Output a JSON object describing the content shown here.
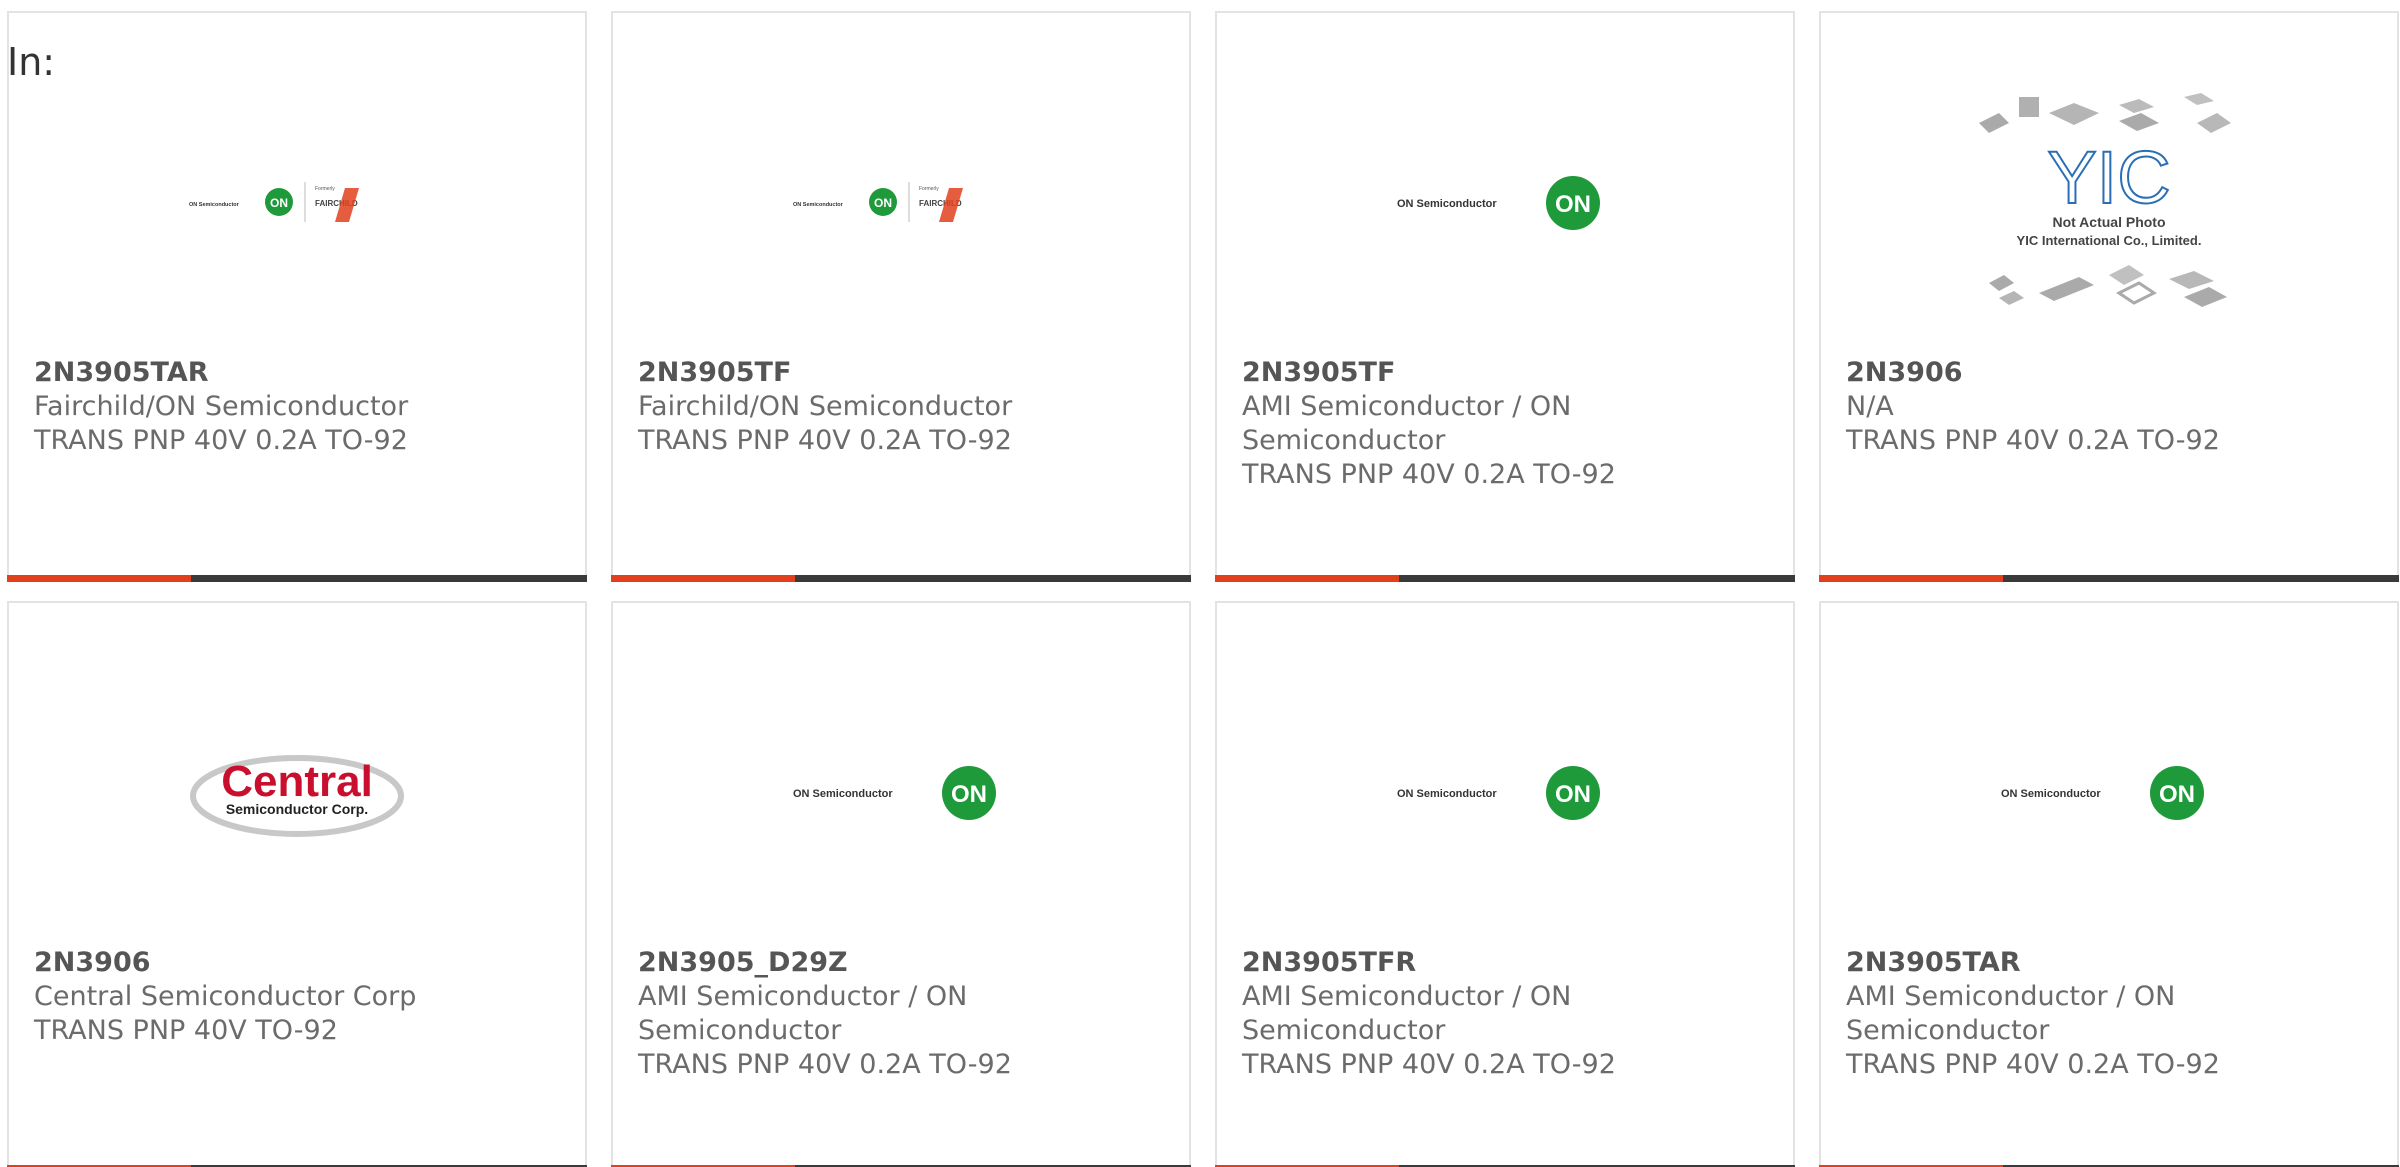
{
  "in_label": "In:",
  "products": [
    {
      "part": "2N3905TAR",
      "manufacturer": "Fairchild/ON Semiconductor",
      "description": "TRANS PNP 40V 0.2A TO-92",
      "logo": "fairchild-on-logo",
      "logo_text": "ON Semiconductor",
      "logo_badge": "ON",
      "logo_extra_small": "Formerly",
      "logo_extra": "FAIRCHILD"
    },
    {
      "part": "2N3905TF",
      "manufacturer": "Fairchild/ON Semiconductor",
      "description": "TRANS PNP 40V 0.2A TO-92",
      "logo": "fairchild-on-logo",
      "logo_text": "ON Semiconductor",
      "logo_badge": "ON",
      "logo_extra_small": "Formerly",
      "logo_extra": "FAIRCHILD"
    },
    {
      "part": "2N3905TF",
      "manufacturer": "AMI Semiconductor / ON Semiconductor",
      "description": "TRANS PNP 40V 0.2A TO-92",
      "logo": "on-semi-logo",
      "logo_text": "ON Semiconductor",
      "logo_badge": "ON"
    },
    {
      "part": "2N3906",
      "manufacturer": "N/A",
      "description": "TRANS PNP 40V 0.2A TO-92",
      "logo": "yic-placeholder-logo",
      "logo_text": "Not Actual Photo",
      "logo_sub": "YIC International Co., Limited.",
      "logo_badge": "YIC"
    },
    {
      "part": "2N3906",
      "manufacturer": "Central Semiconductor Corp",
      "description": "TRANS PNP 40V TO-92",
      "logo": "central-semi-logo",
      "logo_text": "Central",
      "logo_sub": "Semiconductor Corp."
    },
    {
      "part": "2N3905_D29Z",
      "manufacturer": "AMI Semiconductor / ON Semiconductor",
      "description": "TRANS PNP 40V 0.2A TO-92",
      "logo": "on-semi-logo",
      "logo_text": "ON Semiconductor",
      "logo_badge": "ON"
    },
    {
      "part": "2N3905TFR",
      "manufacturer": "AMI Semiconductor / ON Semiconductor",
      "description": "TRANS PNP 40V 0.2A TO-92",
      "logo": "on-semi-logo",
      "logo_text": "ON Semiconductor",
      "logo_badge": "ON"
    },
    {
      "part": "2N3905TAR",
      "manufacturer": "AMI Semiconductor / ON Semiconductor",
      "description": "TRANS PNP 40V 0.2A TO-92",
      "logo": "on-semi-logo",
      "logo_text": "ON Semiconductor",
      "logo_badge": "ON"
    }
  ],
  "colors": {
    "accent": "#e2401c",
    "bar": "#3a3a3a",
    "on_green": "#1f9a3a",
    "central_red": "#c8102e",
    "yic_blue": "#2a6fb5"
  }
}
